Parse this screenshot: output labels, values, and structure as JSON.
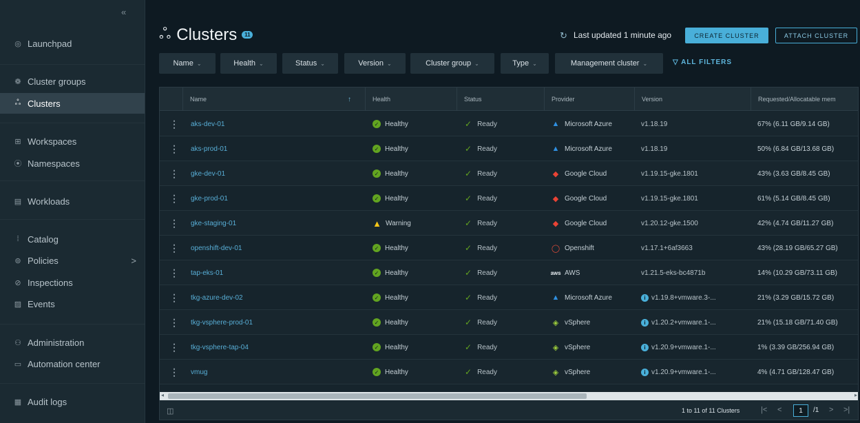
{
  "sidebar": {
    "collapse_label": "«",
    "items": [
      {
        "label": "Launchpad",
        "icon": "launchpad-icon",
        "glyph": "◎"
      },
      {
        "label": "Cluster groups",
        "icon": "cluster-groups-icon",
        "glyph": "❁"
      },
      {
        "label": "Clusters",
        "icon": "clusters-icon",
        "glyph": "ஃ"
      },
      {
        "label": "Workspaces",
        "icon": "workspaces-icon",
        "glyph": "⊞"
      },
      {
        "label": "Namespaces",
        "icon": "namespaces-icon",
        "glyph": "⦿"
      },
      {
        "label": "Workloads",
        "icon": "workloads-icon",
        "glyph": "▤"
      },
      {
        "label": "Catalog",
        "icon": "catalog-icon",
        "glyph": "⁞"
      },
      {
        "label": "Policies",
        "icon": "policies-icon",
        "glyph": "⊚",
        "chevron": ">"
      },
      {
        "label": "Inspections",
        "icon": "inspections-icon",
        "glyph": "⊘"
      },
      {
        "label": "Events",
        "icon": "events-icon",
        "glyph": "▨"
      },
      {
        "label": "Administration",
        "icon": "administration-icon",
        "glyph": "⚇"
      },
      {
        "label": "Automation center",
        "icon": "automation-center-icon",
        "glyph": "▭"
      },
      {
        "label": "Audit logs",
        "icon": "audit-logs-icon",
        "glyph": "▦"
      }
    ]
  },
  "header": {
    "title": "Clusters",
    "title_glyph": "ஃ",
    "count": "11",
    "refresh_glyph": "↻",
    "last_updated": "Last updated 1 minute ago",
    "create_label": "CREATE CLUSTER",
    "attach_label": "ATTACH CLUSTER"
  },
  "filters": {
    "items": [
      "Name",
      "Health",
      "Status",
      "Version",
      "Cluster group",
      "Type",
      "Management cluster"
    ],
    "caret": "⌄",
    "all_filters_label": "▽ ALL FILTERS"
  },
  "table": {
    "columns": [
      "Name",
      "Health",
      "Status",
      "Provider",
      "Version",
      "Requested/Allocatable mem"
    ],
    "sort_arrow": "↑",
    "rows": [
      {
        "name": "aks-dev-01",
        "health": "Healthy",
        "status": "Ready",
        "provider": "Microsoft Azure",
        "provider_type": "azure",
        "version": "v1.18.19",
        "version_info": false,
        "mem": "67% (6.11 GB/9.14 GB)"
      },
      {
        "name": "aks-prod-01",
        "health": "Healthy",
        "status": "Ready",
        "provider": "Microsoft Azure",
        "provider_type": "azure",
        "version": "v1.18.19",
        "version_info": false,
        "mem": "50% (6.84 GB/13.68 GB)"
      },
      {
        "name": "gke-dev-01",
        "health": "Healthy",
        "status": "Ready",
        "provider": "Google Cloud",
        "provider_type": "google",
        "version": "v1.19.15-gke.1801",
        "version_info": false,
        "mem": "43% (3.63 GB/8.45 GB)"
      },
      {
        "name": "gke-prod-01",
        "health": "Healthy",
        "status": "Ready",
        "provider": "Google Cloud",
        "provider_type": "google",
        "version": "v1.19.15-gke.1801",
        "version_info": false,
        "mem": "61% (5.14 GB/8.45 GB)"
      },
      {
        "name": "gke-staging-01",
        "health": "Warning",
        "status": "Ready",
        "provider": "Google Cloud",
        "provider_type": "google",
        "version": "v1.20.12-gke.1500",
        "version_info": false,
        "mem": "42% (4.74 GB/11.27 GB)"
      },
      {
        "name": "openshift-dev-01",
        "health": "Healthy",
        "status": "Ready",
        "provider": "Openshift",
        "provider_type": "openshift",
        "version": "v1.17.1+6af3663",
        "version_info": false,
        "mem": "43% (28.19 GB/65.27 GB)"
      },
      {
        "name": "tap-eks-01",
        "health": "Healthy",
        "status": "Ready",
        "provider": "AWS",
        "provider_type": "aws",
        "version": "v1.21.5-eks-bc4871b",
        "version_info": false,
        "mem": "14% (10.29 GB/73.11 GB)"
      },
      {
        "name": "tkg-azure-dev-02",
        "health": "Healthy",
        "status": "Ready",
        "provider": "Microsoft Azure",
        "provider_type": "azure",
        "version": "v1.19.8+vmware.3-...",
        "version_info": true,
        "mem": "21% (3.29 GB/15.72 GB)"
      },
      {
        "name": "tkg-vsphere-prod-01",
        "health": "Healthy",
        "status": "Ready",
        "provider": "vSphere",
        "provider_type": "vsphere",
        "version": "v1.20.2+vmware.1-...",
        "version_info": true,
        "mem": "21% (15.18 GB/71.40 GB)"
      },
      {
        "name": "tkg-vsphere-tap-04",
        "health": "Healthy",
        "status": "Ready",
        "provider": "vSphere",
        "provider_type": "vsphere",
        "version": "v1.20.9+vmware.1-...",
        "version_info": true,
        "mem": "1% (3.39 GB/256.94 GB)"
      },
      {
        "name": "vmug",
        "health": "Healthy",
        "status": "Ready",
        "provider": "vSphere",
        "provider_type": "vsphere",
        "version": "v1.20.9+vmware.1-...",
        "version_info": true,
        "mem": "4% (4.71 GB/128.47 GB)"
      }
    ]
  },
  "footer": {
    "column_toggle_glyph": "◫",
    "pagination_text": "1 to 11 of 11 Clusters",
    "first": "|<",
    "prev": "<",
    "page": "1",
    "page_total": "/1",
    "next": ">",
    "last": ">|",
    "scroll_left": "◂",
    "scroll_right": "▸"
  },
  "colors": {
    "accent": "#49afd9",
    "healthy": "#62a420",
    "warning": "#f5c518",
    "link": "#58aed6",
    "background": "#0e1a22",
    "sidebar": "#1b2a32"
  }
}
